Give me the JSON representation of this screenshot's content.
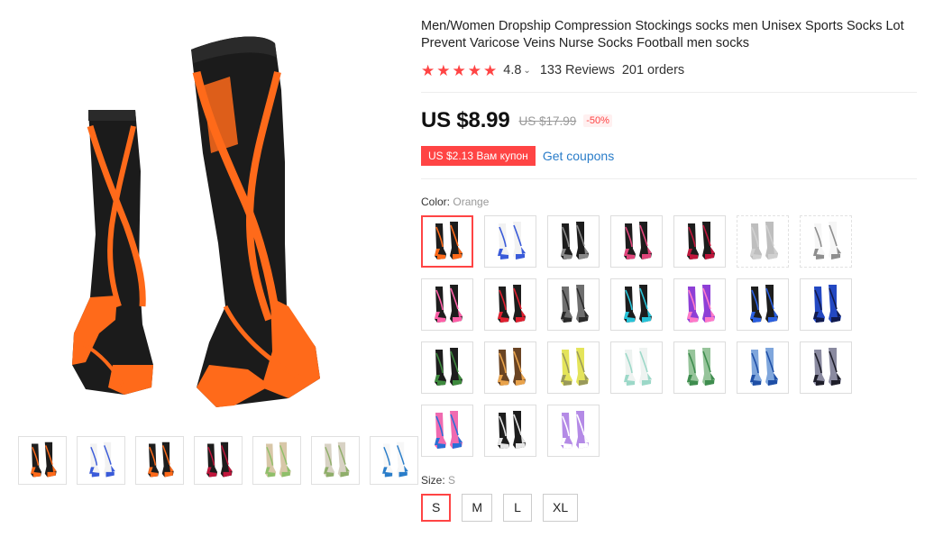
{
  "product": {
    "title": "Men/Women Dropship Compression Stockings socks men Unisex Sports Socks Lot Prevent Varicose Veins Nurse Socks Football men socks",
    "rating": "4.8",
    "reviews": "133 Reviews",
    "orders": "201 orders"
  },
  "price": {
    "current": "US $8.99",
    "original": "US $17.99",
    "discount": "-50%"
  },
  "coupon": {
    "label": "US $2.13 Вам купон",
    "link": "Get coupons"
  },
  "color": {
    "label": "Color:",
    "selected": "Orange",
    "options": [
      {
        "name": "orange-black",
        "accent": "#ff6a1a",
        "base": "#1d1d1d",
        "state": "selected"
      },
      {
        "name": "white-blue",
        "accent": "#3a5bd9",
        "base": "#f2f2f2",
        "state": "normal"
      },
      {
        "name": "black-grey",
        "accent": "#888888",
        "base": "#1d1d1d",
        "state": "normal"
      },
      {
        "name": "black-pink",
        "accent": "#e0457b",
        "base": "#1d1d1d",
        "state": "normal"
      },
      {
        "name": "black-red",
        "accent": "#c0163c",
        "base": "#1d1d1d",
        "state": "normal"
      },
      {
        "name": "grey",
        "accent": "#aaaaaa",
        "base": "#8a8a8a",
        "state": "unavailable"
      },
      {
        "name": "white-black",
        "accent": "#333333",
        "base": "#f0f0f0",
        "state": "unavailable"
      },
      {
        "name": "black-pink-2",
        "accent": "#ff5fa8",
        "base": "#1d1d1d",
        "state": "normal"
      },
      {
        "name": "black-red-2",
        "accent": "#e02030",
        "base": "#1d1d1d",
        "state": "normal"
      },
      {
        "name": "grey-black",
        "accent": "#2a2a2a",
        "base": "#6e6e6e",
        "state": "normal"
      },
      {
        "name": "black-cyan",
        "accent": "#27c3d8",
        "base": "#1d1d1d",
        "state": "normal"
      },
      {
        "name": "purple",
        "accent": "#ff7ac8",
        "base": "#8e3fd6",
        "state": "normal"
      },
      {
        "name": "black-blue",
        "accent": "#2a5fe0",
        "base": "#1d1d1d",
        "state": "normal"
      },
      {
        "name": "blue",
        "accent": "#111a4d",
        "base": "#2348c2",
        "state": "normal"
      },
      {
        "name": "black-green",
        "accent": "#3e8a3e",
        "base": "#1d1d1d",
        "state": "normal"
      },
      {
        "name": "brown-camo",
        "accent": "#e9a34b",
        "base": "#6a4424",
        "state": "normal"
      },
      {
        "name": "yellow",
        "accent": "#9a9a5a",
        "base": "#e4e45a",
        "state": "normal"
      },
      {
        "name": "white-mint",
        "accent": "#9cd8c8",
        "base": "#eef3f1",
        "state": "normal"
      },
      {
        "name": "green-camo",
        "accent": "#3f8d4f",
        "base": "#96c49a",
        "state": "normal"
      },
      {
        "name": "blue-camo",
        "accent": "#1f4fa6",
        "base": "#7fa6dc",
        "state": "normal"
      },
      {
        "name": "grey-camo",
        "accent": "#1e1e2a",
        "base": "#8a8aa0",
        "state": "normal"
      },
      {
        "name": "pink-pattern",
        "accent": "#2a6fd6",
        "base": "#f06ab0",
        "state": "normal"
      },
      {
        "name": "black-white",
        "accent": "#e6e6e6",
        "base": "#1d1d1d",
        "state": "normal"
      },
      {
        "name": "lilac",
        "accent": "#ffffff",
        "base": "#b48ae6",
        "state": "normal"
      }
    ]
  },
  "thumbnails": [
    {
      "name": "thumb-socks-group",
      "accent": "#ff6a1a",
      "base": "#1d1d1d"
    },
    {
      "name": "thumb-white-blue",
      "accent": "#3a5bd9",
      "base": "#f2f2f2"
    },
    {
      "name": "thumb-orange-pair",
      "accent": "#ff6a1a",
      "base": "#1d1d1d"
    },
    {
      "name": "thumb-multi",
      "accent": "#c0163c",
      "base": "#1d1d1d"
    },
    {
      "name": "thumb-runner-photo",
      "accent": "#8fbf6a",
      "base": "#d8c7a8"
    },
    {
      "name": "thumb-collage-photo",
      "accent": "#8fae6a",
      "base": "#d8d2c4"
    },
    {
      "name": "thumb-size-chart",
      "accent": "#2a7dc9",
      "base": "#f7f7f7"
    }
  ],
  "size": {
    "label": "Size:",
    "selected": "S",
    "options": [
      "S",
      "M",
      "L",
      "XL"
    ]
  },
  "colors": {
    "accent_red": "#ff4747",
    "link_blue": "#2a7dc9",
    "main_sock_orange": "#ff6a1a"
  }
}
